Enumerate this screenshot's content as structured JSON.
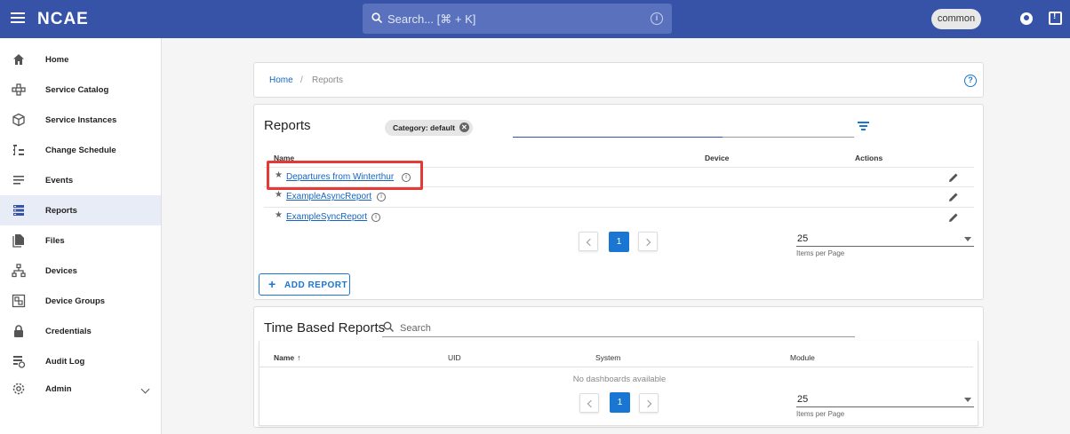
{
  "app": {
    "logo": "NCAE",
    "tenant": "common"
  },
  "search": {
    "placeholder": "Search... [⌘ + K]"
  },
  "sidebar": {
    "items": [
      {
        "label": "Home",
        "icon": "home-icon"
      },
      {
        "label": "Service Catalog",
        "icon": "catalog-icon"
      },
      {
        "label": "Service Instances",
        "icon": "cube-icon"
      },
      {
        "label": "Change Schedule",
        "icon": "schedule-icon"
      },
      {
        "label": "Events",
        "icon": "events-icon"
      },
      {
        "label": "Reports",
        "icon": "reports-icon"
      },
      {
        "label": "Files",
        "icon": "files-icon"
      },
      {
        "label": "Devices",
        "icon": "devices-icon"
      },
      {
        "label": "Device Groups",
        "icon": "device-groups-icon"
      },
      {
        "label": "Credentials",
        "icon": "lock-icon"
      },
      {
        "label": "Audit Log",
        "icon": "audit-log-icon"
      },
      {
        "label": "Admin",
        "icon": "gear-icon"
      }
    ],
    "active": "Reports"
  },
  "breadcrumb": {
    "home": "Home",
    "separator": "/",
    "current": "Reports"
  },
  "reports": {
    "title": "Reports",
    "chip": "Category: default",
    "columns": {
      "name": "Name",
      "device": "Device",
      "actions": "Actions"
    },
    "rows": [
      {
        "name": "Departures from Winterthur"
      },
      {
        "name": "ExampleAsyncReport"
      },
      {
        "name": "ExampleSyncReport"
      }
    ],
    "page": "1",
    "per_page_value": "25",
    "per_page_label": "Items per Page",
    "add_button": "ADD REPORT"
  },
  "time_based": {
    "title": "Time Based Reports",
    "search_placeholder": "Search",
    "columns": {
      "name": "Name",
      "uid": "UID",
      "system": "System",
      "module": "Module"
    },
    "empty": "No dashboards available",
    "page": "1",
    "per_page_value": "25",
    "per_page_label": "Items per Page"
  },
  "colors": {
    "primary": "#3653a8",
    "accent": "#1976d2",
    "highlight": "#e53935"
  }
}
